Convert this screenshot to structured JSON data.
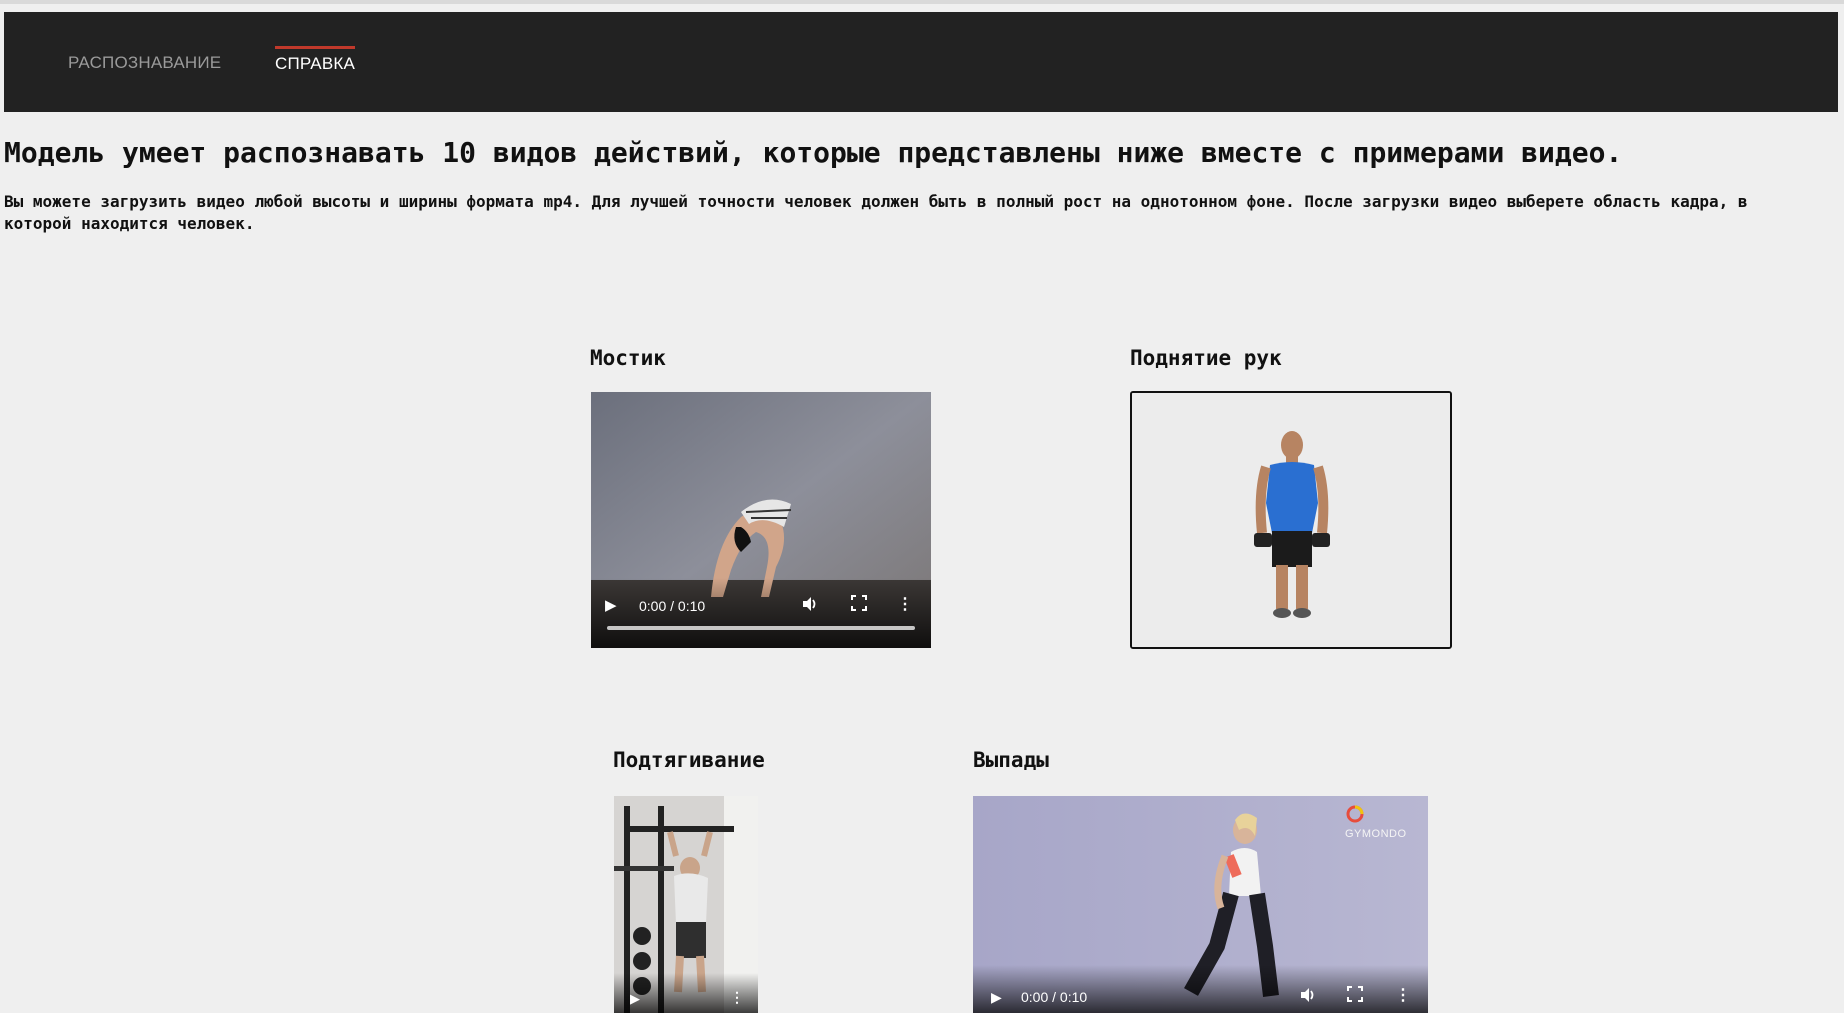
{
  "nav": {
    "recognition_label": "РАСПОЗНАВАНИЕ",
    "help_label": "СПРАВКА"
  },
  "main": {
    "heading": "Модель умеет распознавать 10 видов действий, которые представлены ниже вместе с примерами видео.",
    "intro": "Вы можете загрузить видео любой высоты и ширины формата mp4. Для лучшей точности человек должен быть в полный рост на однотонном фоне. После загрузки видео выберете область кадра, в которой находится человек."
  },
  "examples": [
    {
      "title": "Мостик",
      "time": "0:00 / 0:10"
    },
    {
      "title": "Поднятие рук"
    },
    {
      "title": "Подтягивание"
    },
    {
      "title": "Выпады",
      "time": "0:00 / 0:10",
      "watermark": "GYMONDO"
    }
  ],
  "colors": {
    "navbar_bg": "#222222",
    "active_tab_underline": "#c0392b",
    "page_bg": "#efefef"
  }
}
